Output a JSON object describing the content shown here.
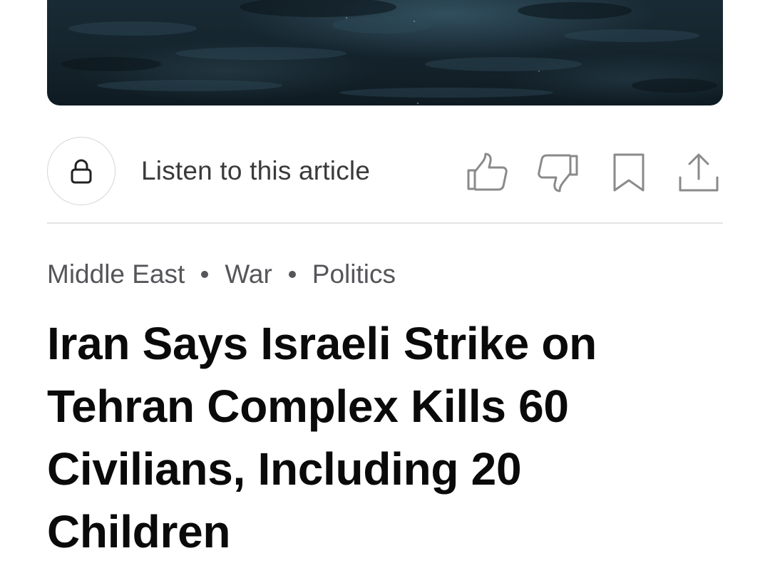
{
  "hero_image": {
    "tone": "#16262f"
  },
  "audio": {
    "listen_label": "Listen to this article",
    "lock_icon": "lock-icon"
  },
  "actions": {
    "like_icon": "thumbs-up-icon",
    "dislike_icon": "thumbs-down-icon",
    "bookmark_icon": "bookmark-icon",
    "share_icon": "share-icon"
  },
  "article": {
    "tags": [
      "Middle East",
      "War",
      "Politics"
    ],
    "headline": "Iran Says Israeli Strike on Tehran Complex Kills 60 Civilians, Including 20 Children"
  },
  "colors": {
    "text_primary": "#0a0a0a",
    "text_secondary": "#55555a",
    "icon": "#8a8a8a",
    "divider": "#e4e4e4"
  }
}
